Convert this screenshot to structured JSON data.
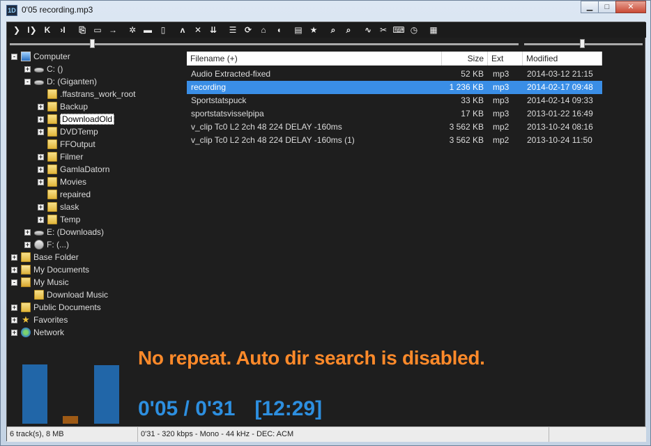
{
  "window": {
    "title": "0'05 recording.mp3",
    "app_icon_text": "1D",
    "buttons": {
      "minimize": "▁",
      "maximize": "□",
      "close": "✕"
    }
  },
  "toolbar": {
    "buttons": [
      {
        "icon": "play-icon",
        "glyph": "❯"
      },
      {
        "icon": "pause-play-icon",
        "glyph": "I❯"
      },
      {
        "icon": "previous-icon",
        "glyph": "K"
      },
      {
        "icon": "next-icon",
        "glyph": "›I"
      },
      {
        "sep": true
      },
      {
        "icon": "open-folder-icon",
        "glyph": "⎘"
      },
      {
        "icon": "folder-next-icon",
        "glyph": "▭"
      },
      {
        "icon": "goto-icon",
        "glyph": "→"
      },
      {
        "sep": true
      },
      {
        "icon": "settings-icon",
        "glyph": "✲"
      },
      {
        "icon": "minimize-view-icon",
        "glyph": "▬"
      },
      {
        "icon": "panel-icon",
        "glyph": "▯"
      },
      {
        "sep": true
      },
      {
        "icon": "up-icon",
        "glyph": "ʌ"
      },
      {
        "icon": "cross-icon",
        "glyph": "✕"
      },
      {
        "icon": "sort-down-icon",
        "glyph": "⇊"
      },
      {
        "sep": true
      },
      {
        "icon": "layout-icon",
        "glyph": "☰"
      },
      {
        "icon": "refresh-icon",
        "glyph": "⟳"
      },
      {
        "icon": "home-icon",
        "glyph": "⌂"
      },
      {
        "icon": "volume-icon",
        "glyph": "◖"
      },
      {
        "sep": true
      },
      {
        "icon": "playlist-icon",
        "glyph": "▤"
      },
      {
        "icon": "favorite-star-icon",
        "glyph": "★"
      },
      {
        "sep": true
      },
      {
        "icon": "search-icon",
        "glyph": "⌕"
      },
      {
        "icon": "search-folder-icon",
        "glyph": "⌕"
      },
      {
        "sep": true
      },
      {
        "icon": "convert-icon",
        "glyph": "∿"
      },
      {
        "icon": "cut-icon",
        "glyph": "✂"
      },
      {
        "icon": "keyboard-icon",
        "glyph": "⌨"
      },
      {
        "icon": "timer-icon",
        "glyph": "◷"
      },
      {
        "sep": true
      },
      {
        "icon": "list-view-icon",
        "glyph": "▦"
      }
    ]
  },
  "sliders": {
    "seek_position": 0.161,
    "volume_level": 0.49
  },
  "tree": {
    "items": [
      {
        "label": "Computer",
        "depth": 0,
        "icon": "computer-icon",
        "exp": "-"
      },
      {
        "label": "C: ()",
        "depth": 1,
        "icon": "drive-icon",
        "exp": "+"
      },
      {
        "label": "D: (Giganten)",
        "depth": 1,
        "icon": "drive-icon",
        "exp": "-"
      },
      {
        "label": ".ffastrans_work_root",
        "depth": 2,
        "icon": "folder-icon",
        "exp": ""
      },
      {
        "label": "Backup",
        "depth": 2,
        "icon": "folder-icon",
        "exp": "+"
      },
      {
        "label": "DownloadOld",
        "depth": 2,
        "icon": "folder-icon",
        "exp": "+",
        "selected": true
      },
      {
        "label": "DVDTemp",
        "depth": 2,
        "icon": "folder-icon",
        "exp": "+"
      },
      {
        "label": "FFOutput",
        "depth": 2,
        "icon": "folder-icon",
        "exp": ""
      },
      {
        "label": "Filmer",
        "depth": 2,
        "icon": "folder-icon",
        "exp": "+"
      },
      {
        "label": "GamlaDatorn",
        "depth": 2,
        "icon": "folder-icon",
        "exp": "+"
      },
      {
        "label": "Movies",
        "depth": 2,
        "icon": "folder-icon",
        "exp": "+"
      },
      {
        "label": "repaired",
        "depth": 2,
        "icon": "folder-icon",
        "exp": ""
      },
      {
        "label": "slask",
        "depth": 2,
        "icon": "folder-icon",
        "exp": "+"
      },
      {
        "label": "Temp",
        "depth": 2,
        "icon": "folder-icon",
        "exp": "+"
      },
      {
        "label": "E: (Downloads)",
        "depth": 1,
        "icon": "drive-icon",
        "exp": "+"
      },
      {
        "label": "F: (...)",
        "depth": 1,
        "icon": "network-drive-icon",
        "exp": "+"
      },
      {
        "label": "Base Folder",
        "depth": 0,
        "icon": "folder-icon",
        "exp": "+"
      },
      {
        "label": "My Documents",
        "depth": 0,
        "icon": "documents-icon",
        "exp": "+"
      },
      {
        "label": "My Music",
        "depth": 0,
        "icon": "music-folder-icon",
        "exp": "-"
      },
      {
        "label": "Download Music",
        "depth": 1,
        "icon": "folder-icon",
        "exp": ""
      },
      {
        "label": "Public Documents",
        "depth": 0,
        "icon": "folder-icon",
        "exp": "+"
      },
      {
        "label": "Favorites",
        "depth": 0,
        "icon": "star-icon",
        "exp": "+"
      },
      {
        "label": "Network",
        "depth": 0,
        "icon": "network-icon",
        "exp": "+"
      }
    ]
  },
  "filelist": {
    "columns": {
      "filename": "Filename (+)",
      "size": "Size",
      "ext": "Ext",
      "modified": "Modified"
    },
    "rows": [
      {
        "name": "Audio Extracted-fixed",
        "size": "52 KB",
        "ext": "mp3",
        "modified": "2014-03-12 21:15"
      },
      {
        "name": "recording",
        "size": "1 236 KB",
        "ext": "mp3",
        "modified": "2014-02-17 09:48",
        "selected": true
      },
      {
        "name": "Sportstatspuck",
        "size": "33 KB",
        "ext": "mp3",
        "modified": "2014-02-14 09:33"
      },
      {
        "name": "sportstatsvisselpipa",
        "size": "17 KB",
        "ext": "mp3",
        "modified": "2013-01-22 16:49"
      },
      {
        "name": "v_clip Tc0 L2 2ch 48 224 DELAY -160ms",
        "size": "3 562 KB",
        "ext": "mp2",
        "modified": "2013-10-24 08:16"
      },
      {
        "name": "v_clip Tc0 L2 2ch 48 224 DELAY -160ms (1)",
        "size": "3 562 KB",
        "ext": "mp2",
        "modified": "2013-10-24 11:50"
      }
    ]
  },
  "visualizer": {
    "colors": {
      "blue": "#2166a8",
      "orange": "#9e5a15"
    },
    "levels": [
      0.75,
      0.1,
      0.74
    ]
  },
  "message": "No repeat. Auto dir search is disabled.",
  "time": {
    "position": "0'05 / 0'31",
    "clock": "[12:29]"
  },
  "statusbar": {
    "tracks": "6 track(s), 8 MB",
    "info": "0'31 - 320 kbps - Mono - 44 kHz - DEC: ACM",
    "extra": ""
  }
}
